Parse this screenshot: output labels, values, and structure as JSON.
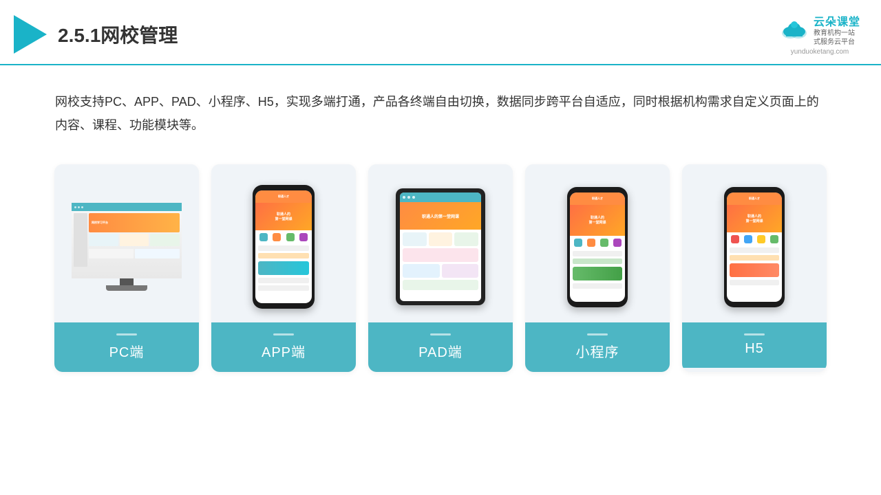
{
  "header": {
    "title": "2.5.1网校管理",
    "brand": {
      "name": "云朵课堂",
      "url": "yunduoketang.com",
      "tagline": "教育机构一站\n式服务云平台"
    }
  },
  "description": "网校支持PC、APP、PAD、小程序、H5，实现多端打通，产品各终端自由切换，数据同步跨平台自适应，同时根据机构需求自定义页面上的内容、课程、功能模块等。",
  "cards": [
    {
      "id": "pc",
      "label": "PC端",
      "device": "pc"
    },
    {
      "id": "app",
      "label": "APP端",
      "device": "phone"
    },
    {
      "id": "pad",
      "label": "PAD端",
      "device": "tablet"
    },
    {
      "id": "miniapp",
      "label": "小程序",
      "device": "phone2"
    },
    {
      "id": "h5",
      "label": "H5",
      "device": "phone3"
    }
  ],
  "colors": {
    "accent": "#4db6c4",
    "brand": "#1ab3c8"
  }
}
